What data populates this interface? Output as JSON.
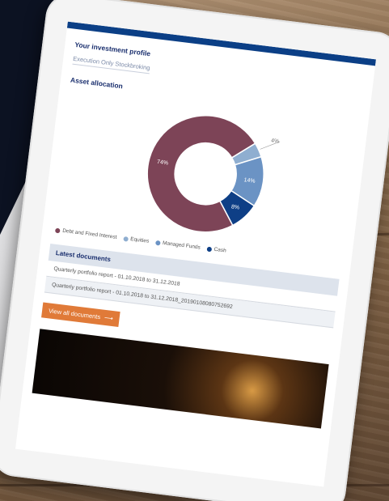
{
  "profile": {
    "title": "Your investment profile",
    "value": "Execution Only Stockbroking"
  },
  "allocation": {
    "title": "Asset allocation",
    "slices": [
      {
        "name": "Debt and Fixed Interest",
        "value": 74,
        "label": "74%",
        "color": "#7d4457"
      },
      {
        "name": "Equities",
        "value": 4,
        "label": "4%",
        "color": "#8faed0"
      },
      {
        "name": "Managed Funds",
        "value": 14,
        "label": "14%",
        "color": "#6b93c4"
      },
      {
        "name": "Cash",
        "value": 8,
        "label": "8%",
        "color": "#0e3f86"
      }
    ]
  },
  "docs": {
    "title": "Latest documents",
    "items": [
      "Quarterly portfolio report - 01.10.2018 to 31.12.2018",
      "Quarterly portfolio report - 01.10.2018 to 31.12.2018_20190108080752692"
    ],
    "button_label": "View all documents",
    "button_arrow": "⟶"
  },
  "keys": {
    "up": "⇧",
    "play": "▸"
  }
}
